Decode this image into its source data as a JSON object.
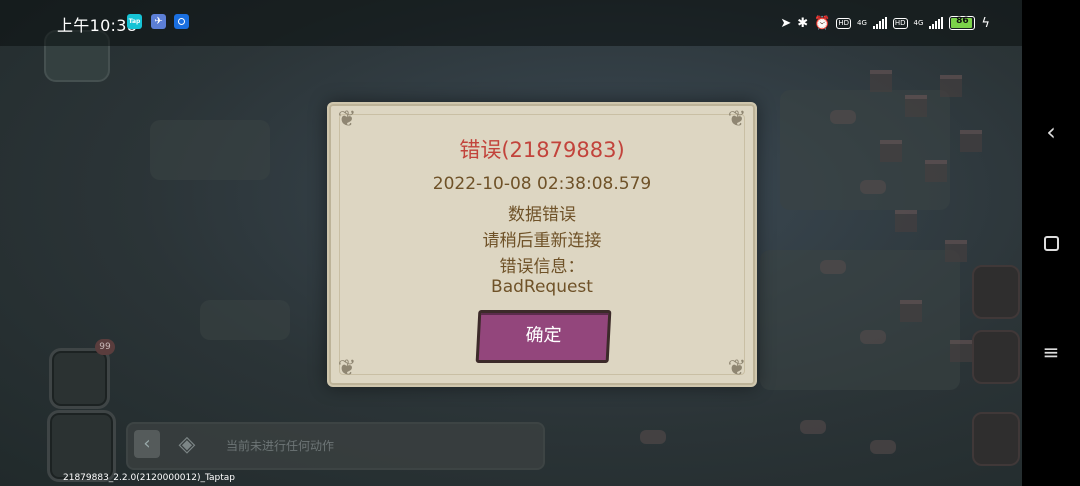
{
  "status_bar": {
    "time": "上午10:38",
    "taptap_label": "Tap",
    "network_type": "4G",
    "hd_label": "HD",
    "battery": "86"
  },
  "dialog": {
    "title": "错误(21879883)",
    "timestamp": "2022-10-08 02:38:08.579",
    "message": "数据错误",
    "instruction": "请稍后重新连接",
    "info_label": "错误信息：",
    "error_detail": "BadRequest",
    "confirm_label": "确定"
  },
  "game": {
    "chat_badge": "99",
    "ticker_text": "当前未进行任何动作"
  },
  "footer": {
    "build_info": "21879883_2.2.0(2120000012)_Taptap"
  },
  "icons": {
    "back": "chevron-left-icon",
    "home": "square-icon",
    "menu": "menu-icon"
  },
  "colors": {
    "title": "#c2433b",
    "text": "#6f5228",
    "button": "#93467c",
    "panel": "#ddd6c2"
  }
}
